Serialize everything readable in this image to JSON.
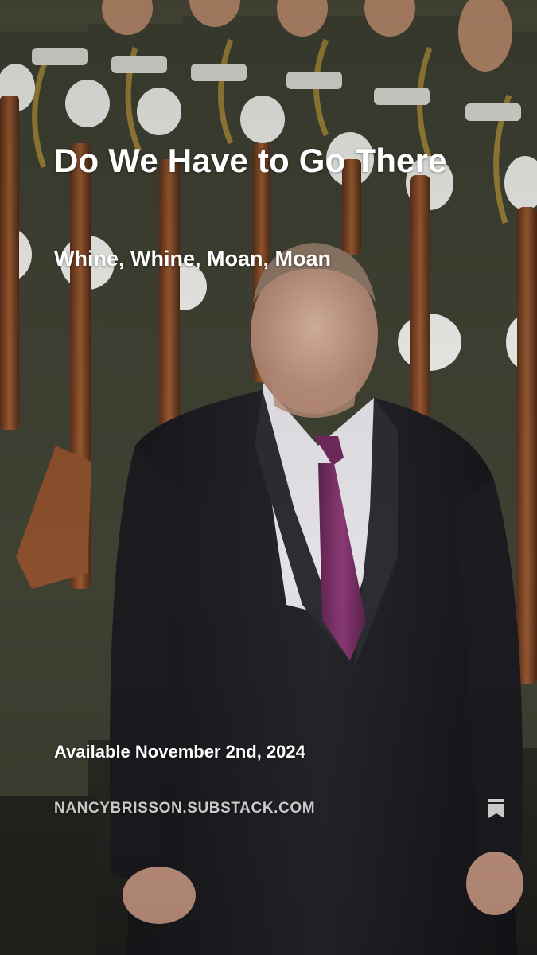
{
  "post": {
    "title": "Do We Have to Go There",
    "subtitle": "Whine, Whine, Moan, Moan",
    "availability": "Available November 2nd, 2024",
    "site": "NANCYBRISSON.SUBSTACK.COM"
  },
  "icons": {
    "bookmark": "bookmark-icon"
  },
  "colors": {
    "text": "#ffffff",
    "site_text": "#c9c9c9",
    "tie": "#7a2e63"
  }
}
